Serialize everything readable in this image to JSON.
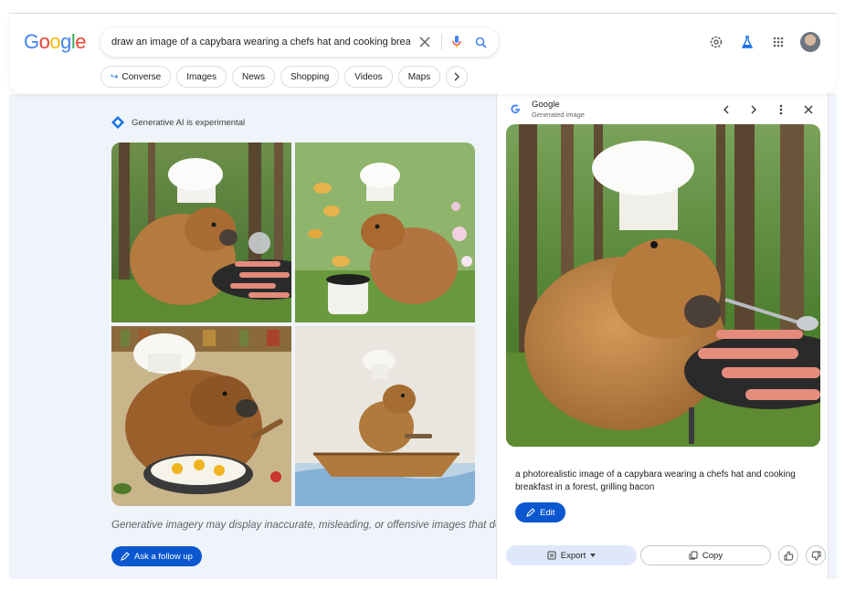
{
  "logo": {
    "letters": [
      "G",
      "o",
      "o",
      "g",
      "l",
      "e"
    ],
    "colors": [
      "#4285f4",
      "#ea4335",
      "#fbbc05",
      "#4285f4",
      "#34a853",
      "#ea4335"
    ]
  },
  "search": {
    "query": "draw an image of a capybara wearing a chefs hat and cooking breakfast",
    "clear_icon": "close-icon",
    "mic_icon": "mic-icon",
    "search_icon": "search-icon"
  },
  "top_right": {
    "icons": [
      "settings-icon",
      "labs-icon",
      "apps-icon"
    ],
    "avatar": "avatar"
  },
  "chips": [
    {
      "label": "Converse",
      "icon": "return-arrow-icon"
    },
    {
      "label": "Images"
    },
    {
      "label": "News"
    },
    {
      "label": "Shopping"
    },
    {
      "label": "Videos"
    },
    {
      "label": "Maps"
    }
  ],
  "ai": {
    "note": "Generative AI is experimental",
    "disclaimer": "Generative imagery may display inaccurate, misleading, or offensive images that do",
    "followup_label": "Ask a follow up"
  },
  "images": [
    {
      "name": "capybara-grilling-forest"
    },
    {
      "name": "capybara-flipping-pancakes"
    },
    {
      "name": "capybara-frying-eggs"
    },
    {
      "name": "capybara-in-boat"
    }
  ],
  "panel": {
    "source_title": "Google",
    "source_subtitle": "Generated image",
    "caption": "a photorealistic image of a capybara wearing a chefs hat and cooking breakfast in a forest, grilling bacon",
    "edit_label": "Edit",
    "export_label": "Export",
    "copy_label": "Copy"
  },
  "colors": {
    "accent": "#0b57d0",
    "panel_bg": "#eff3fa"
  }
}
